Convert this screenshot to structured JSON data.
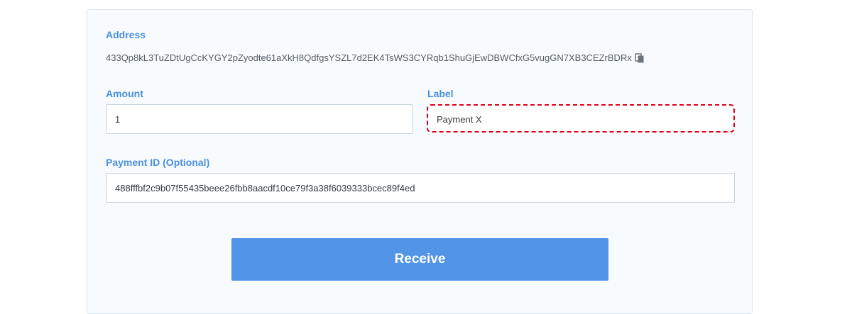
{
  "address": {
    "label": "Address",
    "value": "433Qp8kL3TuZDtUgCcKYGY2pZyodte61aXkH8QdfgsYSZL7d2EK4TsWS3CYRqb1ShuGjEwDBWCfxG5vugGN7XB3CEZrBDRx",
    "copy_icon": "copy-icon"
  },
  "amount": {
    "label": "Amount",
    "value": "1"
  },
  "label_field": {
    "label": "Label",
    "value": "Payment X"
  },
  "payment_id": {
    "label": "Payment ID (Optional)",
    "value": "488fffbf2c9b07f55435beee26fbb8aacdf10ce79f3a38f6039333bcec89f4ed"
  },
  "receive_button": {
    "label": "Receive"
  },
  "colors": {
    "accent": "#4a8fdb",
    "button": "#5294e8",
    "highlight": "#e0001a"
  }
}
